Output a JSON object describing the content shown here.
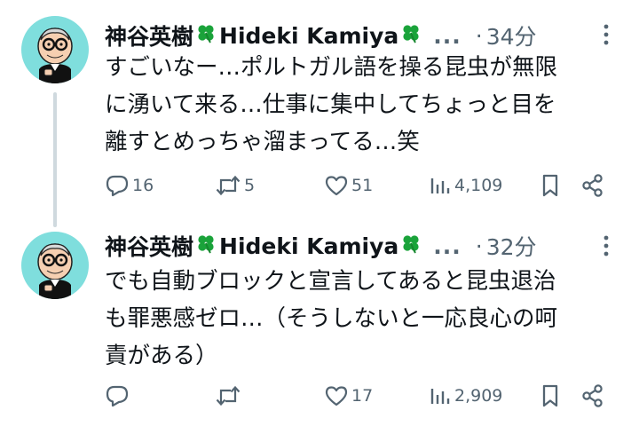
{
  "tweets": [
    {
      "display_name": "神谷英樹",
      "handle_name": "Hideki Kamiya",
      "truncation": "...",
      "dot": "·",
      "time": "34分",
      "text_lines": [
        "すごいなー…ポルトガル語を操る昆虫が無限",
        "に湧いて来る…仕事に集中してちょっと目を",
        "離すとめっちゃ溜まってる…笑"
      ],
      "replies": "16",
      "retweets": "5",
      "likes": "51",
      "views": "4,109"
    },
    {
      "display_name": "神谷英樹",
      "handle_name": "Hideki Kamiya",
      "truncation": "...",
      "dot": "·",
      "time": "32分",
      "text_lines": [
        "でも自動ブロックと宣言してあると昆虫退治",
        "も罪悪感ゼロ…（そうしないと一応良心の呵",
        "責がある）"
      ],
      "replies": "",
      "retweets": "",
      "likes": "17",
      "views": "2,909"
    }
  ],
  "colors": {
    "text_primary": "#0f1419",
    "text_secondary": "#536471",
    "clover": "#1aa33a",
    "avatar_bg": "#7fdedd",
    "thread_line": "#cfd9de"
  },
  "icons": {
    "emoji": "four-leaf-clover",
    "actions": [
      "reply-icon",
      "retweet-icon",
      "like-icon",
      "views-icon",
      "bookmark-icon",
      "share-icon"
    ],
    "menu": "more-icon"
  }
}
